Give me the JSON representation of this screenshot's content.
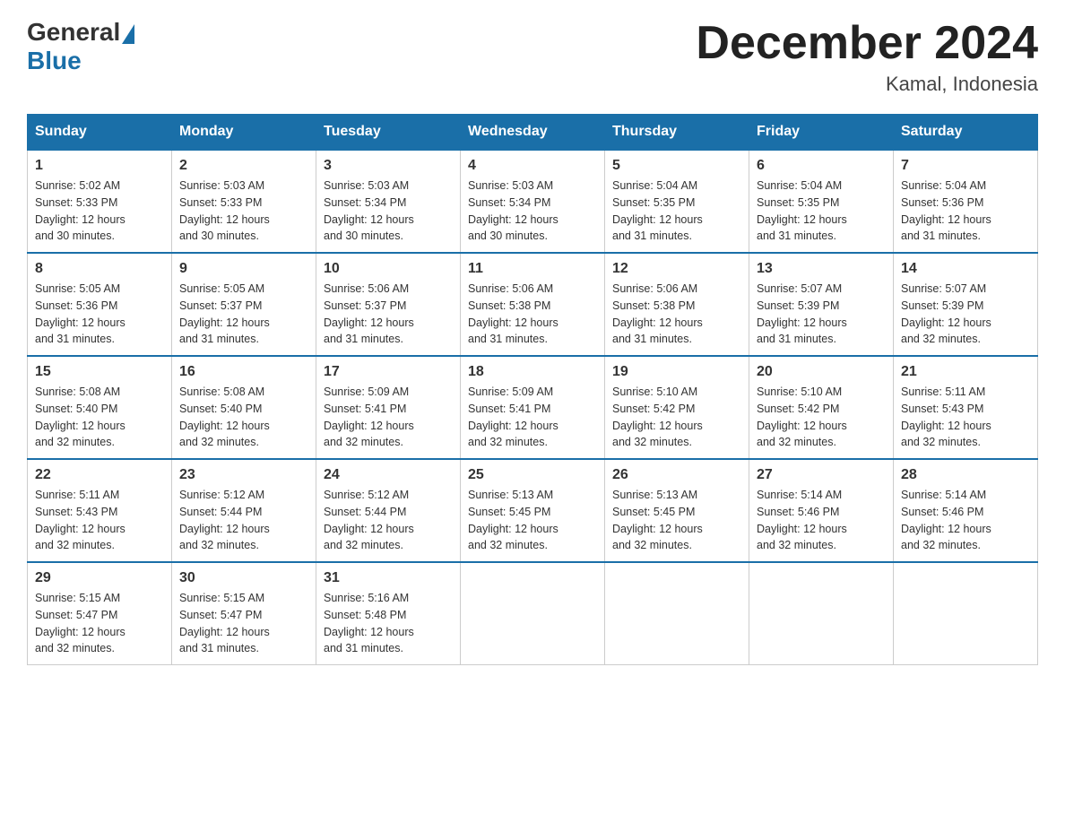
{
  "logo": {
    "general": "General",
    "blue": "Blue"
  },
  "title": "December 2024",
  "subtitle": "Kamal, Indonesia",
  "headers": [
    "Sunday",
    "Monday",
    "Tuesday",
    "Wednesday",
    "Thursday",
    "Friday",
    "Saturday"
  ],
  "weeks": [
    [
      {
        "num": "1",
        "sunrise": "5:02 AM",
        "sunset": "5:33 PM",
        "daylight": "12 hours and 30 minutes."
      },
      {
        "num": "2",
        "sunrise": "5:03 AM",
        "sunset": "5:33 PM",
        "daylight": "12 hours and 30 minutes."
      },
      {
        "num": "3",
        "sunrise": "5:03 AM",
        "sunset": "5:34 PM",
        "daylight": "12 hours and 30 minutes."
      },
      {
        "num": "4",
        "sunrise": "5:03 AM",
        "sunset": "5:34 PM",
        "daylight": "12 hours and 30 minutes."
      },
      {
        "num": "5",
        "sunrise": "5:04 AM",
        "sunset": "5:35 PM",
        "daylight": "12 hours and 31 minutes."
      },
      {
        "num": "6",
        "sunrise": "5:04 AM",
        "sunset": "5:35 PM",
        "daylight": "12 hours and 31 minutes."
      },
      {
        "num": "7",
        "sunrise": "5:04 AM",
        "sunset": "5:36 PM",
        "daylight": "12 hours and 31 minutes."
      }
    ],
    [
      {
        "num": "8",
        "sunrise": "5:05 AM",
        "sunset": "5:36 PM",
        "daylight": "12 hours and 31 minutes."
      },
      {
        "num": "9",
        "sunrise": "5:05 AM",
        "sunset": "5:37 PM",
        "daylight": "12 hours and 31 minutes."
      },
      {
        "num": "10",
        "sunrise": "5:06 AM",
        "sunset": "5:37 PM",
        "daylight": "12 hours and 31 minutes."
      },
      {
        "num": "11",
        "sunrise": "5:06 AM",
        "sunset": "5:38 PM",
        "daylight": "12 hours and 31 minutes."
      },
      {
        "num": "12",
        "sunrise": "5:06 AM",
        "sunset": "5:38 PM",
        "daylight": "12 hours and 31 minutes."
      },
      {
        "num": "13",
        "sunrise": "5:07 AM",
        "sunset": "5:39 PM",
        "daylight": "12 hours and 31 minutes."
      },
      {
        "num": "14",
        "sunrise": "5:07 AM",
        "sunset": "5:39 PM",
        "daylight": "12 hours and 32 minutes."
      }
    ],
    [
      {
        "num": "15",
        "sunrise": "5:08 AM",
        "sunset": "5:40 PM",
        "daylight": "12 hours and 32 minutes."
      },
      {
        "num": "16",
        "sunrise": "5:08 AM",
        "sunset": "5:40 PM",
        "daylight": "12 hours and 32 minutes."
      },
      {
        "num": "17",
        "sunrise": "5:09 AM",
        "sunset": "5:41 PM",
        "daylight": "12 hours and 32 minutes."
      },
      {
        "num": "18",
        "sunrise": "5:09 AM",
        "sunset": "5:41 PM",
        "daylight": "12 hours and 32 minutes."
      },
      {
        "num": "19",
        "sunrise": "5:10 AM",
        "sunset": "5:42 PM",
        "daylight": "12 hours and 32 minutes."
      },
      {
        "num": "20",
        "sunrise": "5:10 AM",
        "sunset": "5:42 PM",
        "daylight": "12 hours and 32 minutes."
      },
      {
        "num": "21",
        "sunrise": "5:11 AM",
        "sunset": "5:43 PM",
        "daylight": "12 hours and 32 minutes."
      }
    ],
    [
      {
        "num": "22",
        "sunrise": "5:11 AM",
        "sunset": "5:43 PM",
        "daylight": "12 hours and 32 minutes."
      },
      {
        "num": "23",
        "sunrise": "5:12 AM",
        "sunset": "5:44 PM",
        "daylight": "12 hours and 32 minutes."
      },
      {
        "num": "24",
        "sunrise": "5:12 AM",
        "sunset": "5:44 PM",
        "daylight": "12 hours and 32 minutes."
      },
      {
        "num": "25",
        "sunrise": "5:13 AM",
        "sunset": "5:45 PM",
        "daylight": "12 hours and 32 minutes."
      },
      {
        "num": "26",
        "sunrise": "5:13 AM",
        "sunset": "5:45 PM",
        "daylight": "12 hours and 32 minutes."
      },
      {
        "num": "27",
        "sunrise": "5:14 AM",
        "sunset": "5:46 PM",
        "daylight": "12 hours and 32 minutes."
      },
      {
        "num": "28",
        "sunrise": "5:14 AM",
        "sunset": "5:46 PM",
        "daylight": "12 hours and 32 minutes."
      }
    ],
    [
      {
        "num": "29",
        "sunrise": "5:15 AM",
        "sunset": "5:47 PM",
        "daylight": "12 hours and 32 minutes."
      },
      {
        "num": "30",
        "sunrise": "5:15 AM",
        "sunset": "5:47 PM",
        "daylight": "12 hours and 31 minutes."
      },
      {
        "num": "31",
        "sunrise": "5:16 AM",
        "sunset": "5:48 PM",
        "daylight": "12 hours and 31 minutes."
      },
      null,
      null,
      null,
      null
    ]
  ]
}
